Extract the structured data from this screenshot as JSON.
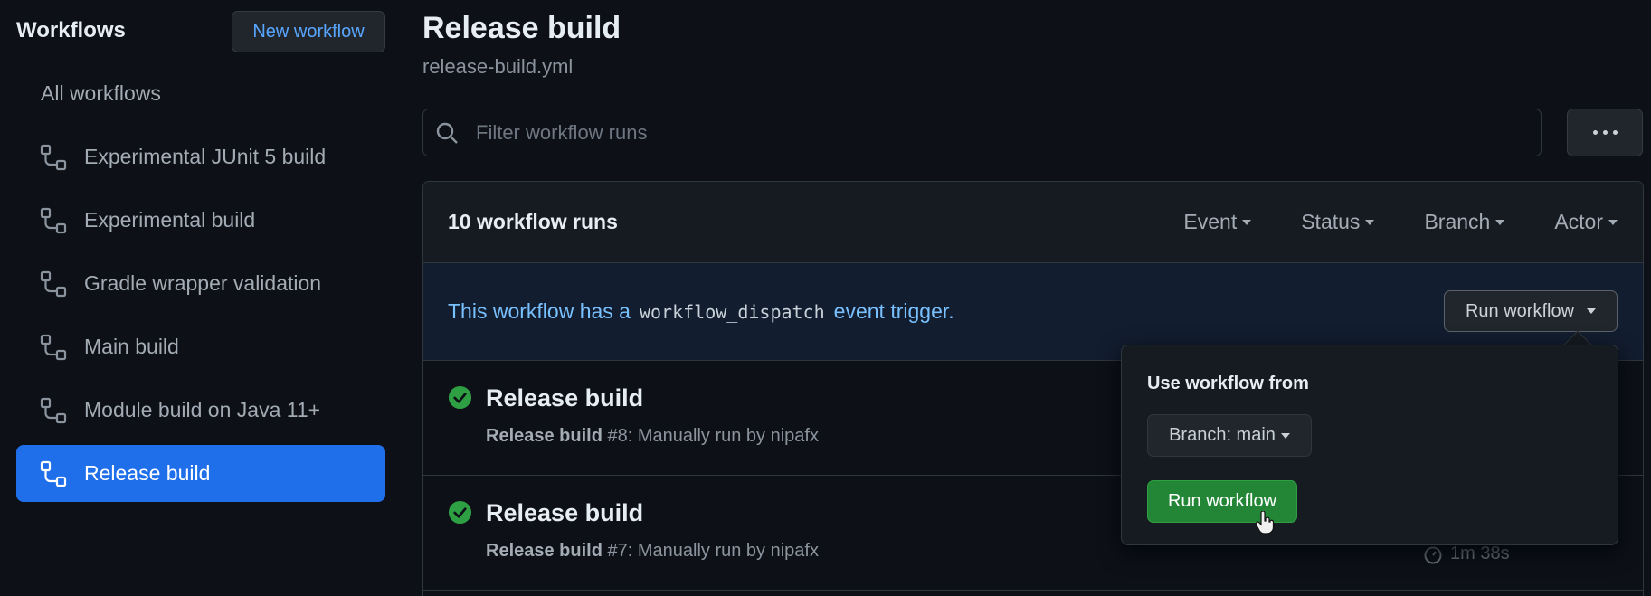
{
  "sidebar": {
    "title": "Workflows",
    "new_workflow_label": "New workflow",
    "all_workflows_label": "All workflows",
    "items": [
      {
        "label": "Experimental JUnit 5 build"
      },
      {
        "label": "Experimental build"
      },
      {
        "label": "Gradle wrapper validation"
      },
      {
        "label": "Main build"
      },
      {
        "label": "Module build on Java 11+"
      },
      {
        "label": "Release build",
        "active": true
      }
    ]
  },
  "header": {
    "title": "Release build",
    "file": "release-build.yml"
  },
  "search": {
    "placeholder": "Filter workflow runs",
    "value": ""
  },
  "runs": {
    "count_label": "10 workflow runs",
    "filters": [
      {
        "label": "Event"
      },
      {
        "label": "Status"
      },
      {
        "label": "Branch"
      },
      {
        "label": "Actor"
      }
    ],
    "dispatch": {
      "text_before": "This workflow has a",
      "code": "workflow_dispatch",
      "text_after": "event trigger.",
      "button_label": "Run workflow"
    },
    "items": [
      {
        "title": "Release build",
        "meta_bold": "Release build",
        "meta": " #8: Manually run by nipafx",
        "status": "success"
      },
      {
        "title": "Release build",
        "meta_bold": "Release build",
        "meta": " #7: Manually run by nipafx",
        "status": "success",
        "duration": "1m 38s"
      }
    ]
  },
  "popover": {
    "label": "Use workflow from",
    "branch_label": "Branch: main",
    "run_label": "Run workflow"
  },
  "colors": {
    "background": "#0d1117",
    "accent_blue": "#1f6feb",
    "link_blue": "#58a6ff",
    "success_green": "#2ea043",
    "run_button_green": "#238636"
  }
}
